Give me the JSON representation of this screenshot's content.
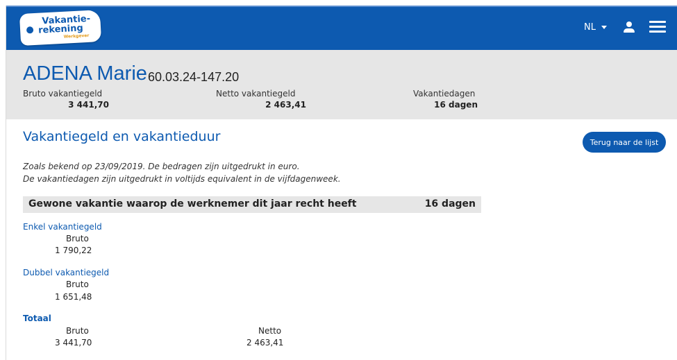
{
  "header": {
    "logo": {
      "line1": "Vakantie-",
      "line2": "rekening",
      "line3": "Werkgever"
    },
    "language": "NL"
  },
  "identity": {
    "name": "ADENA Marie",
    "national_number": "60.03.24-147.20",
    "bruto_label": "Bruto vakantiegeld",
    "bruto_value": "3 441,70",
    "netto_label": "Netto vakantiegeld",
    "netto_value": "2 463,41",
    "days_label": "Vakantiedagen",
    "days_value": "16 dagen"
  },
  "main": {
    "title": "Vakantiegeld en vakantieduur",
    "back_button": "Terug naar de lijst",
    "note_line1": "Zoals bekend op 23/09/2019. De bedragen zijn uitgedrukt in euro.",
    "note_line2": "De vakantiedagen zijn uitgedrukt in voltijds equivalent in de vijfdagenweek.",
    "entitlement_label": "Gewone vakantie waarop de werknemer dit jaar recht heeft",
    "entitlement_value": "16 dagen",
    "enkel": {
      "title": "Enkel vakantiegeld",
      "bruto_label": "Bruto",
      "bruto_value": "1 790,22"
    },
    "dubbel": {
      "title": "Dubbel vakantiegeld",
      "bruto_label": "Bruto",
      "bruto_value": "1 651,48"
    },
    "totaal": {
      "title": "Totaal",
      "bruto_label": "Bruto",
      "bruto_value": "3 441,70",
      "netto_label": "Netto",
      "netto_value": "2 463,41"
    }
  },
  "colors": {
    "brand_blue": "#0d5ab0",
    "panel_grey": "#e6e6e6",
    "logo_accent": "#e39b1b"
  },
  "icons": [
    "user-icon",
    "hamburger-menu-icon",
    "caret-down-icon"
  ]
}
